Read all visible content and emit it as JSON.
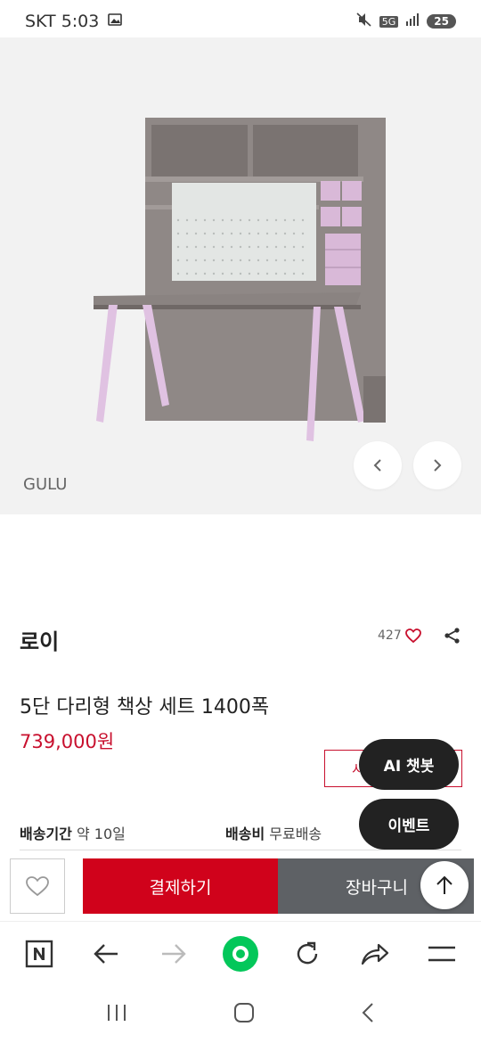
{
  "status_bar": {
    "carrier_time": "SKT 5:03",
    "network": "5G",
    "battery": "25"
  },
  "hero": {
    "brand": "GULU"
  },
  "shop": {
    "name": "로이",
    "likes": "427"
  },
  "product": {
    "title": "5단 다리형 책상 세트 1400폭",
    "price": "739,000원"
  },
  "floating": {
    "outline_btn_label": "시",
    "ai_chatbot": "AI 챗봇",
    "event": "이벤트"
  },
  "shipping": {
    "period_label": "배송기간",
    "period_value": "약 10일",
    "fee_label": "배송비",
    "fee_value": "무료배송"
  },
  "actions": {
    "pay": "결제하기",
    "cart": "장바구니"
  },
  "icons": {
    "wish": "heart-outline-icon",
    "share": "share-icon",
    "scroll_top": "arrow-up-icon",
    "browser": [
      "naver-home-icon",
      "back-arrow-icon",
      "forward-arrow-icon",
      "green-dot-icon",
      "refresh-icon",
      "share-forward-icon",
      "menu-icon"
    ]
  },
  "colors": {
    "accent": "#d0021b",
    "price": "#c8102e",
    "cart_bg": "#5e6165",
    "dark_pill": "#222222"
  }
}
